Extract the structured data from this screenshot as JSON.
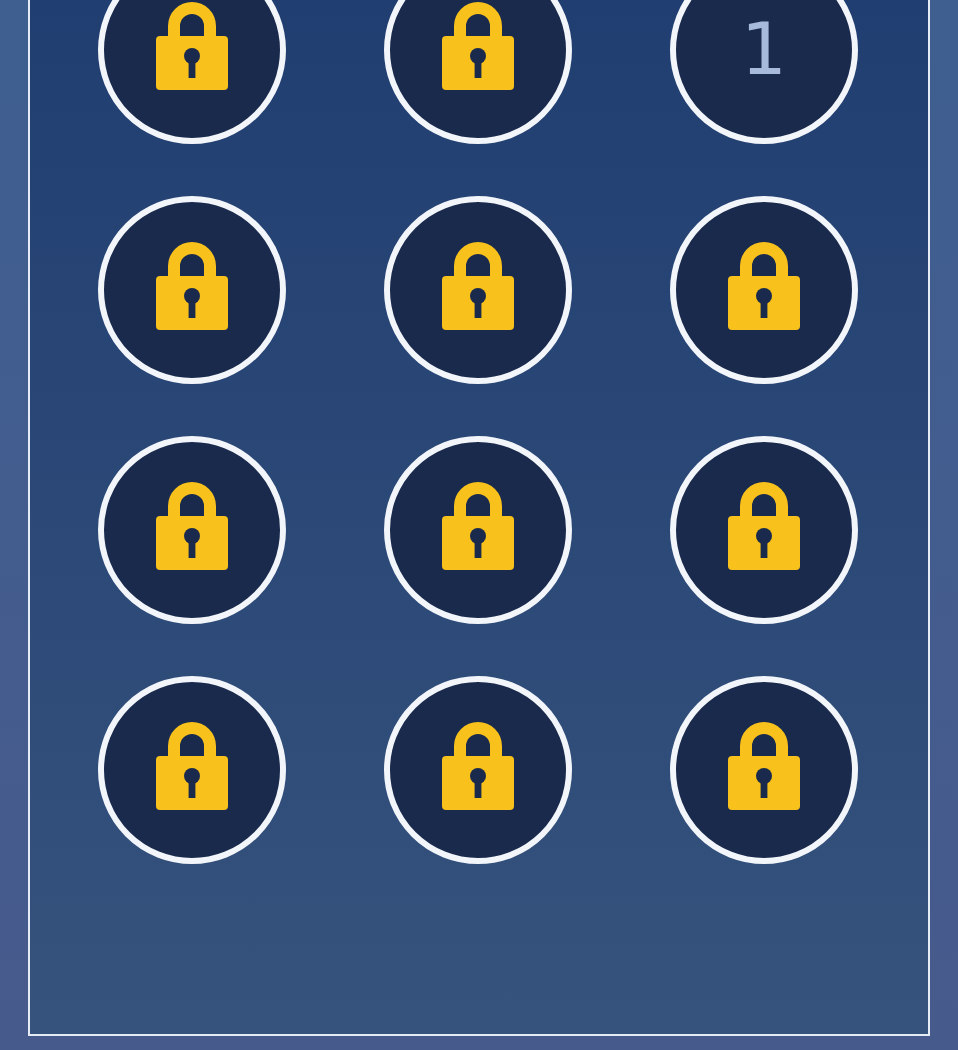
{
  "levels": [
    {
      "locked": true
    },
    {
      "locked": true
    },
    {
      "locked": false,
      "label": "1"
    },
    {
      "locked": true
    },
    {
      "locked": true
    },
    {
      "locked": true
    },
    {
      "locked": true
    },
    {
      "locked": true
    },
    {
      "locked": true
    },
    {
      "locked": true
    },
    {
      "locked": true
    },
    {
      "locked": true
    }
  ]
}
